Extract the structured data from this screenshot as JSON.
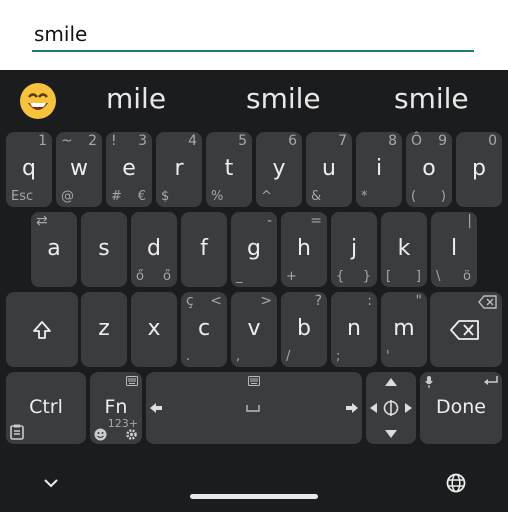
{
  "field": {
    "value": "smile"
  },
  "suggestions": [
    "mile",
    "smile",
    "smile"
  ],
  "emoji_label": "😄",
  "row1": [
    {
      "main": "q",
      "tl": "",
      "tr": "1",
      "bl": "Esc",
      "br": ""
    },
    {
      "main": "w",
      "tl": "~",
      "tr": "2",
      "bl": "@",
      "br": ""
    },
    {
      "main": "e",
      "tl": "!",
      "tr": "3",
      "bl": "#",
      "br": "€"
    },
    {
      "main": "r",
      "tl": "",
      "tr": "4",
      "bl": "$",
      "br": ""
    },
    {
      "main": "t",
      "tl": "",
      "tr": "5",
      "bl": "%",
      "br": ""
    },
    {
      "main": "y",
      "tl": "",
      "tr": "6",
      "bl": "^",
      "br": ""
    },
    {
      "main": "u",
      "tl": "",
      "tr": "7",
      "bl": "&",
      "br": ""
    },
    {
      "main": "i",
      "tl": "",
      "tr": "8",
      "bl": "*",
      "br": ""
    },
    {
      "main": "o",
      "tl": "Ô",
      "tr": "9",
      "bl": "(",
      "br": ")"
    },
    {
      "main": "p",
      "tl": "",
      "tr": "0",
      "bl": "",
      "br": ""
    }
  ],
  "row2": [
    {
      "main": "a",
      "tl": "⇄",
      "tr": "",
      "bl": "",
      "br": ""
    },
    {
      "main": "s",
      "tl": "",
      "tr": "",
      "bl": "",
      "br": ""
    },
    {
      "main": "d",
      "tl": "",
      "tr": "",
      "bl": "ő",
      "br": "ő"
    },
    {
      "main": "f",
      "tl": "",
      "tr": "",
      "bl": "",
      "br": ""
    },
    {
      "main": "g",
      "tl": "",
      "tr": "-",
      "bl": "_",
      "br": ""
    },
    {
      "main": "h",
      "tl": "",
      "tr": "=",
      "bl": "+",
      "br": ""
    },
    {
      "main": "j",
      "tl": "",
      "tr": "",
      "bl": "{",
      "br": "}"
    },
    {
      "main": "k",
      "tl": "",
      "tr": "",
      "bl": "[",
      "br": "]"
    },
    {
      "main": "l",
      "tl": "",
      "tr": "|",
      "bl": "\\",
      "br": "ö"
    }
  ],
  "row3": [
    {
      "main": "z",
      "tl": "",
      "tr": "",
      "bl": "",
      "br": ""
    },
    {
      "main": "x",
      "tl": "",
      "tr": "",
      "bl": "",
      "br": ""
    },
    {
      "main": "c",
      "tl": "ç",
      "tr": "<",
      "bl": ".",
      "br": ""
    },
    {
      "main": "v",
      "tl": "",
      "tr": ">",
      "bl": ",",
      "br": ""
    },
    {
      "main": "b",
      "tl": "",
      "tr": "?",
      "bl": "/",
      "br": ""
    },
    {
      "main": "n",
      "tl": "",
      "tr": ":",
      "bl": ";",
      "br": ""
    },
    {
      "main": "m",
      "tl": "",
      "tr": "\"",
      "bl": "'",
      "br": ""
    }
  ],
  "bottom": {
    "ctrl": "Ctrl",
    "fn": "Fn",
    "fn_sub": "123+",
    "done": "Done"
  },
  "icons": {
    "shift": "shift-icon",
    "backspace": "backspace-icon",
    "keyboard": "keyboard-icon",
    "emoji": "emoji-icon",
    "settings": "settings-icon",
    "clipboard": "clipboard-icon",
    "arrow-left": "arrow-left-icon",
    "arrow-right": "arrow-right-icon",
    "space": "space-icon",
    "dpad": "dpad-icon",
    "mic": "mic-icon",
    "enter": "enter-icon",
    "hide-keyboard": "chevron-down-icon",
    "globe": "globe-icon"
  },
  "colors": {
    "accent": "#1a7f72",
    "key": "#3b3c3f",
    "background": "#1b1c1e"
  }
}
